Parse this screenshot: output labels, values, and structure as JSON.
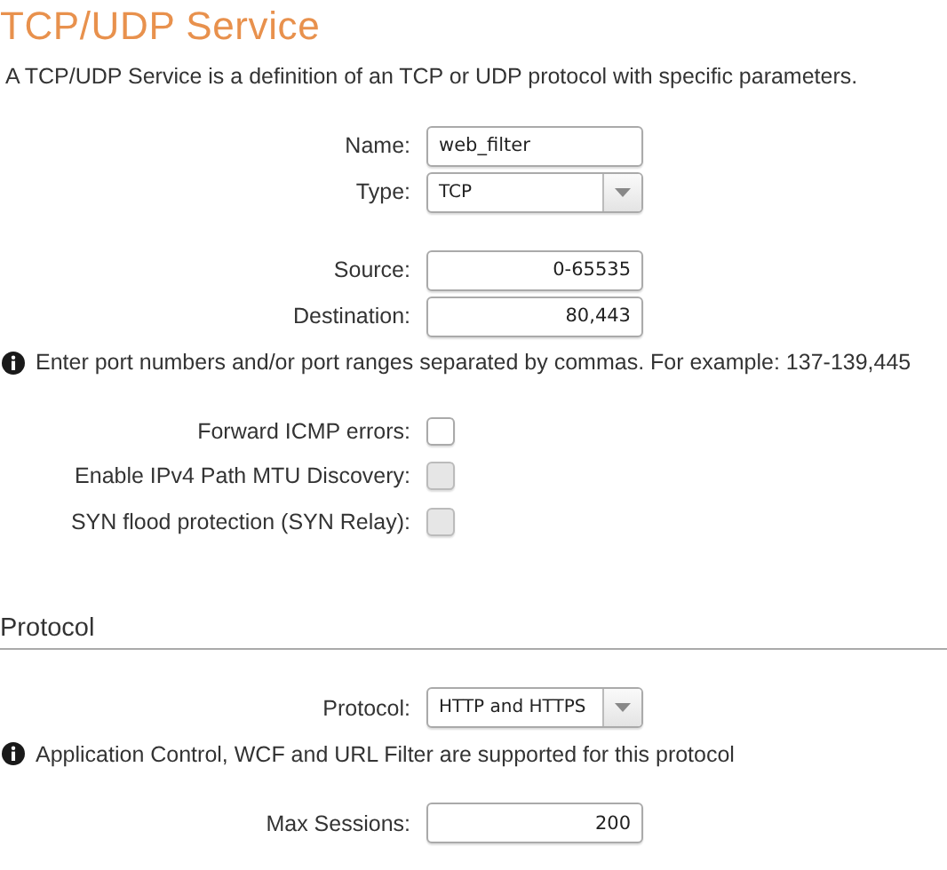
{
  "title": "TCP/UDP Service",
  "description": "A TCP/UDP Service is a definition of an TCP or UDP protocol with specific parameters.",
  "groups": [
    {
      "items": [
        {
          "kind": "text",
          "label": "Name:",
          "value": "web_filter"
        },
        {
          "kind": "select",
          "label": "Type:",
          "value": "TCP"
        }
      ]
    },
    {
      "items": [
        {
          "kind": "number",
          "label": "Source:",
          "value": "0-65535"
        },
        {
          "kind": "number",
          "label": "Destination:",
          "value": "80,443"
        },
        {
          "kind": "note",
          "text": "Enter port numbers and/or port ranges separated by commas. For example: 137-139,445"
        }
      ]
    },
    {
      "items": [
        {
          "kind": "checkbox",
          "label": "Forward ICMP errors:",
          "checked": false,
          "disabled": false
        },
        {
          "kind": "checkbox",
          "label": "Enable IPv4 Path MTU Discovery:",
          "checked": false,
          "disabled": true
        },
        {
          "kind": "checkbox",
          "label": "SYN flood protection (SYN Relay):",
          "checked": false,
          "disabled": true
        }
      ]
    },
    {
      "heading": "Protocol",
      "items": [
        {
          "kind": "select",
          "label": "Protocol:",
          "value": "HTTP and HTTPS"
        },
        {
          "kind": "note",
          "text": "Application Control, WCF and URL Filter are supported for this protocol"
        }
      ]
    },
    {
      "items": [
        {
          "kind": "number",
          "label": "Max Sessions:",
          "value": "200"
        }
      ]
    }
  ]
}
